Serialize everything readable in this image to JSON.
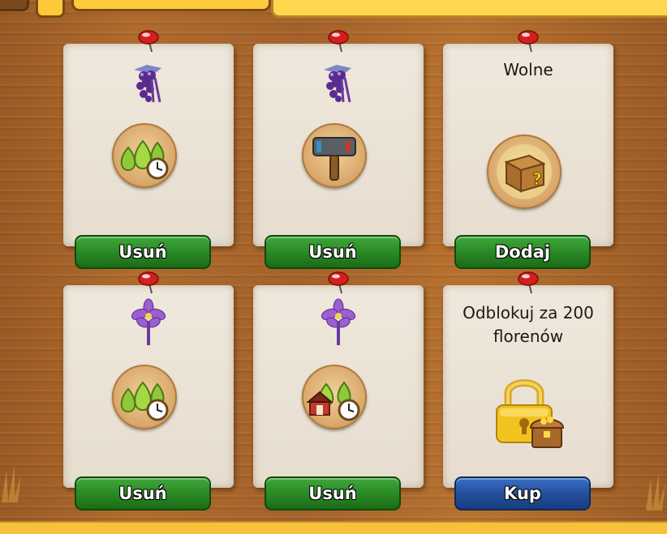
{
  "colors": {
    "wood": "#a4622a",
    "paper": "#ece4d7",
    "button_green": "#2b8a26",
    "button_blue": "#24509e",
    "badge": "#d9a86a"
  },
  "slots": [
    {
      "plant_icon": "purple-grapes-icon",
      "item_icon": "fertilizer-drops-clock-icon",
      "button_label": "Usuń",
      "button_style": "green"
    },
    {
      "plant_icon": "purple-grapes-icon",
      "item_icon": "hammer-icon",
      "button_label": "Usuń",
      "button_style": "green"
    },
    {
      "status_text": "Wolne",
      "item_icon": "mystery-box-icon",
      "button_label": "Dodaj",
      "button_style": "green"
    },
    {
      "plant_icon": "purple-crocus-icon",
      "item_icon": "fertilizer-drops-clock-icon",
      "button_label": "Usuń",
      "button_style": "green"
    },
    {
      "plant_icon": "purple-crocus-icon",
      "item_icon": "farm-fertilizer-clock-icon",
      "button_label": "Usuń",
      "button_style": "green"
    },
    {
      "status_text": "Odblokuj za 200\nflorenów",
      "item_icon": "padlock-treasure-icon",
      "button_label": "Kup",
      "button_style": "blue"
    }
  ]
}
